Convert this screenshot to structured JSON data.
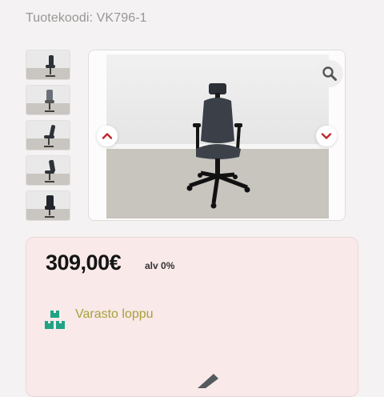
{
  "product": {
    "code_label": "Tuotekoodi: VK796-1"
  },
  "gallery": {
    "thumbnails": [
      {
        "name": "thumbnail-1",
        "view": "front-left"
      },
      {
        "name": "thumbnail-2",
        "view": "back"
      },
      {
        "name": "thumbnail-3",
        "view": "side"
      },
      {
        "name": "thumbnail-4",
        "view": "side-back"
      },
      {
        "name": "thumbnail-5",
        "view": "front"
      }
    ],
    "prev_icon": "chevron-up-icon",
    "next_icon": "chevron-down-icon",
    "zoom_icon": "search-icon"
  },
  "pricing": {
    "price": "309,00€",
    "vat": "alv 0%"
  },
  "stock": {
    "status": "Varasto loppu",
    "icon": "boxes-icon"
  },
  "colors": {
    "accent": "#c0282d",
    "stock_text": "#a8a13a",
    "stock_icon": "#1fa384",
    "card_bg": "#f9e9e9"
  }
}
